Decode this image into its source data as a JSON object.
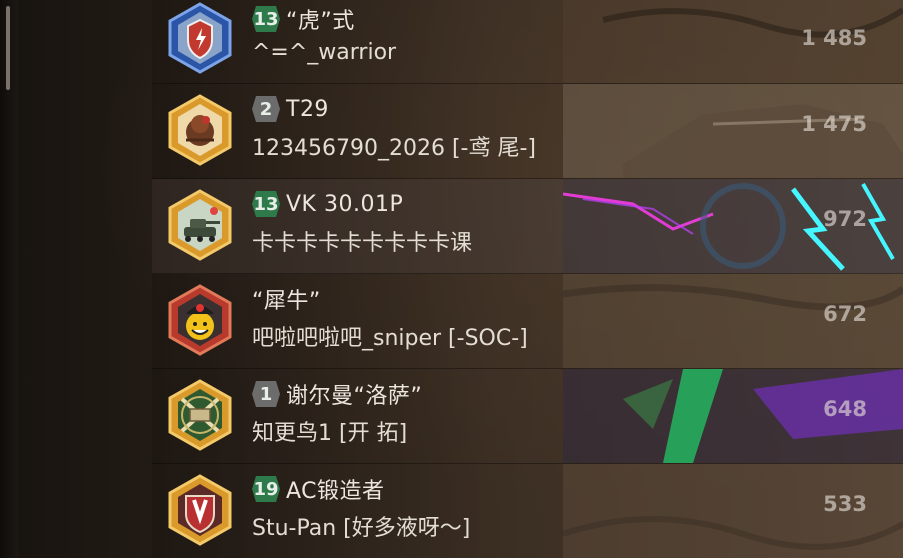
{
  "rows": [
    {
      "tier": "13",
      "tier_color": "#2f7a4a",
      "tank": "“虎”式",
      "player": "^=^_warrior",
      "score": "1 485",
      "badge_color": "#3563b8",
      "badge_icon": "shield-icon"
    },
    {
      "tier": "2",
      "tier_color": "#6c6c6c",
      "tank": "T29",
      "player": "123456790_2026 [-鸢 尾-]",
      "score": "1 475",
      "badge_color": "#c9922a",
      "badge_icon": "turkey-icon"
    },
    {
      "tier": "13",
      "tier_color": "#2f7a4a",
      "tank": "VK 30.01P",
      "player": "卡卡卡卡卡卡卡卡卡课",
      "score": "972",
      "badge_color": "#c9922a",
      "badge_icon": "tank-icon"
    },
    {
      "tier": "",
      "tier_color": "",
      "tank": "“犀牛”",
      "player": "吧啦吧啦吧_sniper [-SOC-]",
      "score": "672",
      "badge_color": "#c24a3a",
      "badge_icon": "smiley-icon"
    },
    {
      "tier": "1",
      "tier_color": "#6c6c6c",
      "tank": "谢尔曼“洛萨”",
      "player": "知更鸟1 [开 拓]",
      "score": "648",
      "badge_color": "#c9922a",
      "badge_icon": "crossed-swords-icon"
    },
    {
      "tier": "19",
      "tier_color": "#2f7a4a",
      "tank": "AC锻造者",
      "player": "Stu-Pan [好多液呀～]",
      "score": "533",
      "badge_color": "#c9922a",
      "badge_icon": "lightning-shield-icon"
    }
  ]
}
